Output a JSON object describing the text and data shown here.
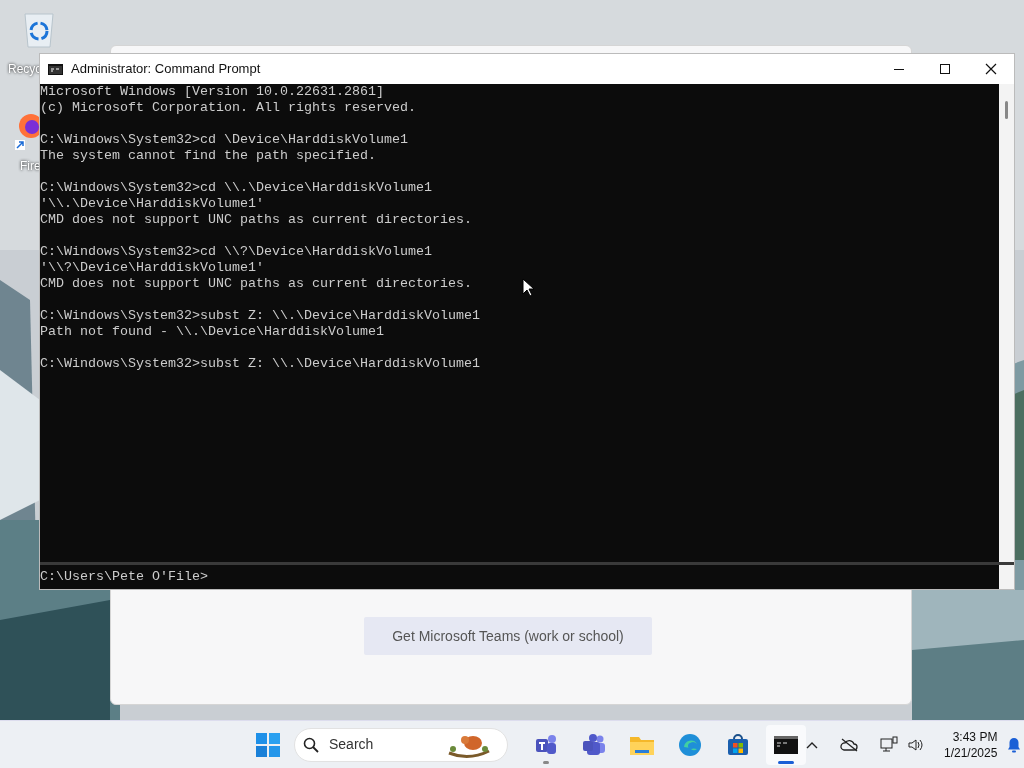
{
  "desktop_icons": [
    {
      "kind": "recycle",
      "label": "Recyc"
    },
    {
      "kind": "browser",
      "label": "Fire"
    }
  ],
  "background_window": {
    "button": "Get Microsoft Teams (work or school)"
  },
  "window": {
    "title": "Administrator: Command Prompt"
  },
  "console_blocks": [
    [
      "Microsoft Windows [Version 10.0.22631.2861]",
      "(c) Microsoft Corporation. All rights reserved."
    ],
    [
      "C:\\Windows\\System32>cd \\Device\\HarddiskVolume1",
      "The system cannot find the path specified."
    ],
    [
      "C:\\Windows\\System32>cd \\\\.\\Device\\HarddiskVolume1",
      "'\\\\.\\Device\\HarddiskVolume1'",
      "CMD does not support UNC paths as current directories."
    ],
    [
      "C:\\Windows\\System32>cd \\\\?\\Device\\HarddiskVolume1",
      "'\\\\?\\Device\\HarddiskVolume1'",
      "CMD does not support UNC paths as current directories."
    ],
    [
      "C:\\Windows\\System32>subst Z: \\\\.\\Device\\HarddiskVolume1",
      "Path not found - \\\\.\\Device\\HarddiskVolume1"
    ],
    [
      "C:\\Windows\\System32>subst Z: \\\\.\\Device\\HarddiskVolume1"
    ]
  ],
  "lower_pane": {
    "prompt": "C:\\Users\\Pete O'File>"
  },
  "taskbar": {
    "search_placeholder": "Search",
    "apps": [
      {
        "kind": "teams-chat",
        "running": true,
        "selected": false
      },
      {
        "kind": "teams",
        "running": false,
        "selected": false
      },
      {
        "kind": "folder",
        "running": false,
        "selected": false
      },
      {
        "kind": "edge",
        "running": false,
        "selected": false
      },
      {
        "kind": "store",
        "running": false,
        "selected": false
      },
      {
        "kind": "terminal",
        "running": true,
        "selected": true
      }
    ],
    "time": "3:43 PM",
    "date": "1/21/2025"
  }
}
